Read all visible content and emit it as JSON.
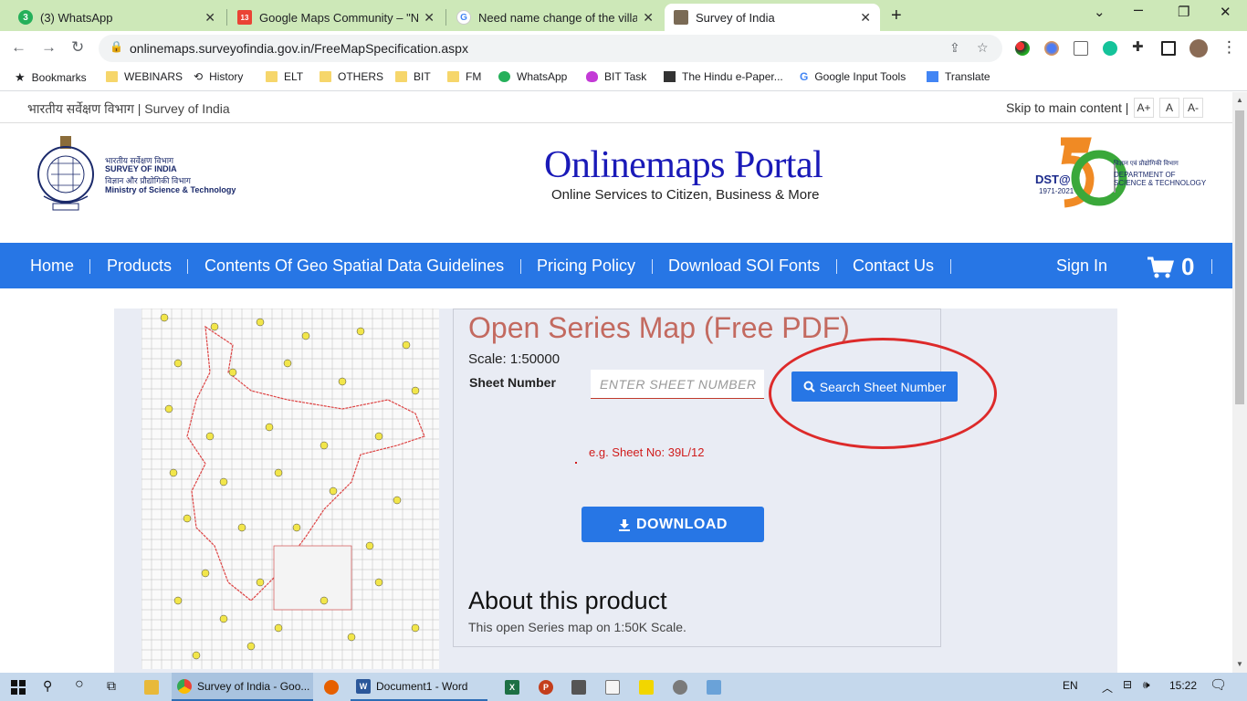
{
  "tabs": [
    {
      "title": "(3) WhatsApp",
      "badge": "3"
    },
    {
      "title": "Google Maps Community – \"Nee",
      "badge": "13"
    },
    {
      "title": "Need name change of the village",
      "badge": "G"
    },
    {
      "title": "Survey of India",
      "badge": ""
    }
  ],
  "url": "onlinemaps.surveyofindia.gov.in/FreeMapSpecification.aspx",
  "bookmarks": [
    "Bookmarks",
    "WEBINARS",
    "History",
    "ELT",
    "OTHERS",
    "BIT",
    "FM",
    "WhatsApp",
    "BIT Task",
    "The Hindu e-Paper...",
    "Google Input Tools",
    "Translate"
  ],
  "topbar": {
    "site_name": "भारतीय सर्वेक्षण विभाग | Survey of India",
    "skip": "Skip to main content |",
    "font_plus": "A+",
    "font_normal": "A",
    "font_minus": "A-"
  },
  "logo_left": {
    "line1": "भारतीय सर्वेक्षण विभाग",
    "line2": "SURVEY OF INDIA",
    "line3": "विज्ञान और प्रौद्योगिकी विभाग",
    "line4": "Ministry of Science & Technology"
  },
  "header": {
    "title": "Onlinemaps Portal",
    "subtitle": "Online Services to Citizen, Business & More"
  },
  "logo_right": {
    "dst": "DST@",
    "years": "1971-2021",
    "hindi": "विज्ञान एवं प्रौद्योगिकी विभाग",
    "dept1": "DEPARTMENT OF",
    "dept2": "SCIENCE & TECHNOLOGY"
  },
  "nav": {
    "items": [
      "Home",
      "Products",
      "Contents Of Geo Spatial Data Guidelines",
      "Pricing Policy",
      "Download SOI Fonts",
      "Contact Us"
    ],
    "sign_in": "Sign In",
    "cart_count": "0"
  },
  "product": {
    "title": "Open Series Map (Free PDF)",
    "scale": "Scale: 1:50000",
    "sheet_label": "Sheet Number",
    "sheet_placeholder": "ENTER SHEET NUMBER",
    "search_button": "Search Sheet Number",
    "example": "e.g. Sheet No: 39L/12",
    "download_button": "DOWNLOAD",
    "about_title": "About this product",
    "about_desc": "This open Series map on 1:50K Scale."
  },
  "taskbar": {
    "apps": [
      "Survey of India - Goo...",
      "Document1 - Word"
    ],
    "lang": "EN",
    "time": "15:22"
  },
  "colors": {
    "nav_blue": "#2776e5",
    "title_red": "#c36a60",
    "annotation_red": "#dd2a2a",
    "portal_blue": "#1a1ab8"
  }
}
